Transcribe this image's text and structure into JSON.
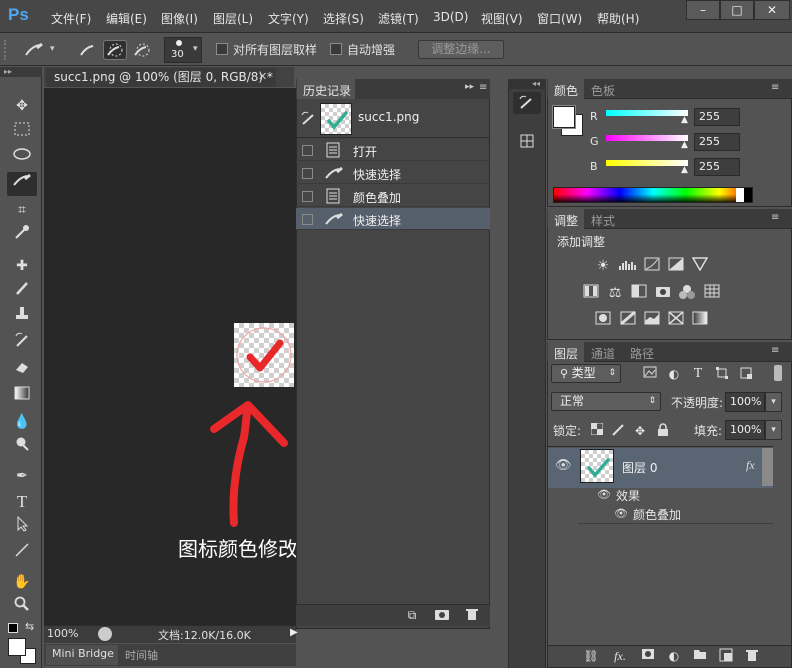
{
  "app": {
    "logo": "Ps"
  },
  "menu": [
    "文件(F)",
    "编辑(E)",
    "图像(I)",
    "图层(L)",
    "文字(Y)",
    "选择(S)",
    "滤镜(T)",
    "3D(D)",
    "视图(V)",
    "窗口(W)",
    "帮助(H)"
  ],
  "window_controls": {
    "minimize": "–",
    "maximize": "□",
    "close": "✕"
  },
  "options_bar": {
    "brush_size": "30",
    "sample_all_layers": "对所有图层取样",
    "auto_enhance": "自动增强",
    "refine_edge": "调整边缘..."
  },
  "document": {
    "tab_title": "succ1.png @ 100% (图层 0, RGB/8) *",
    "zoom": "100%",
    "info": "文档:12.0K/16.0K",
    "annotation": "图标颜色修改为指定的颜色",
    "check_color": "#e8282b",
    "arrow_color": "#e8282b"
  },
  "bottom_tabs": [
    "Mini Bridge",
    "时间轴"
  ],
  "history": {
    "title": "历史记录",
    "snapshot": "succ1.png",
    "items": [
      "打开",
      "快速选择",
      "颜色叠加",
      "快速选择"
    ],
    "selected_index": 3
  },
  "color_panel": {
    "tabs": [
      "颜色",
      "色板"
    ],
    "labels": [
      "R",
      "G",
      "B"
    ],
    "values": [
      "255",
      "255",
      "255"
    ]
  },
  "adjust_panel": {
    "tabs": [
      "调整",
      "样式"
    ],
    "heading": "添加调整"
  },
  "layers_panel": {
    "tabs": [
      "图层",
      "通道",
      "路径"
    ],
    "filter": "类型",
    "blend_mode": "正常",
    "opacity_label": "不透明度:",
    "opacity": "100%",
    "lock_label": "锁定:",
    "fill_label": "填充:",
    "fill": "100%",
    "layer_name": "图层 0",
    "effects_label": "效果",
    "effect_item": "颜色叠加",
    "thumb_check_color": "#2fae93"
  }
}
